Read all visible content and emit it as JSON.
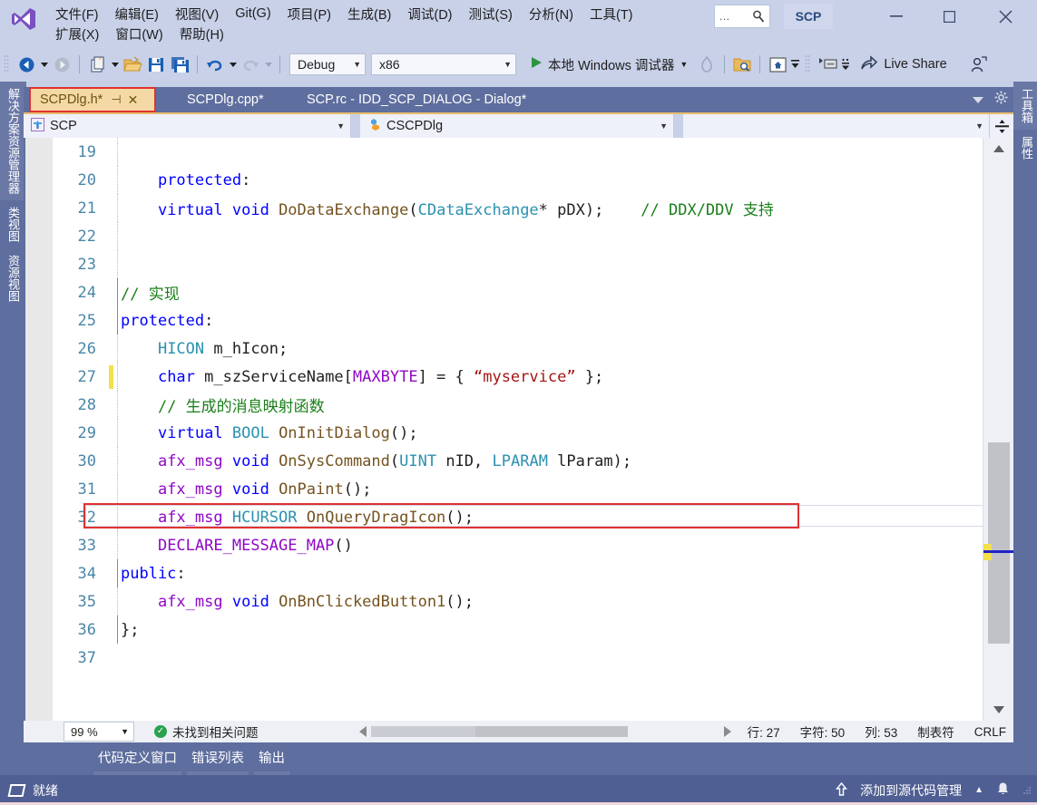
{
  "menu": {
    "logo": "visual-studio-logo",
    "row1": [
      {
        "label": "文件(F)",
        "accel": "F"
      },
      {
        "label": "编辑(E)",
        "accel": "E"
      },
      {
        "label": "视图(V)",
        "accel": "V"
      },
      {
        "label": "Git(G)",
        "accel": "G"
      },
      {
        "label": "项目(P)",
        "accel": "P"
      },
      {
        "label": "生成(B)",
        "accel": "B"
      },
      {
        "label": "调试(D)",
        "accel": "D"
      },
      {
        "label": "测试(S)",
        "accel": "S"
      },
      {
        "label": "分析(N)",
        "accel": "N"
      },
      {
        "label": "工具(T)",
        "accel": "T"
      }
    ],
    "row2": [
      {
        "label": "扩展(X)",
        "accel": "X"
      },
      {
        "label": "窗口(W)",
        "accel": "W"
      },
      {
        "label": "帮助(H)",
        "accel": "H"
      }
    ],
    "search_placeholder": "...",
    "project_badge": "SCP",
    "window_min": "–",
    "window_max": "□",
    "window_close": "✕"
  },
  "toolbar": {
    "back_icon": "back-arrow-icon",
    "forward_icon": "forward-arrow-icon",
    "new_item_icon": "new-item-icon",
    "open_icon": "open-folder-icon",
    "save_icon": "save-icon",
    "save_all_icon": "save-all-icon",
    "undo_icon": "undo-icon",
    "redo_icon": "redo-icon",
    "config_value": "Debug",
    "platform_value": "x86",
    "run_label": "本地 Windows 调试器",
    "hot_reload_icon": "hot-reload-icon",
    "find_icon": "find-in-files-icon",
    "home_icon": "solution-explorer-icon",
    "properties_icon": "properties-window-icon",
    "live_share_label": "Live Share",
    "live_share_icon": "share-icon",
    "feedback_icon": "feedback-icon"
  },
  "left_tool_tabs": [
    {
      "label": "解决方案资源管理器",
      "selected": true
    },
    {
      "label": "类视图",
      "selected": false
    },
    {
      "label": "资源视图",
      "selected": false
    }
  ],
  "right_tool_tabs": [
    {
      "label": "工具箱",
      "selected": false
    },
    {
      "label": "属性",
      "selected": false
    }
  ],
  "document_tabs": [
    {
      "label": "SCPDlg.h*",
      "active": true,
      "pin": "⊣",
      "close": "✕"
    },
    {
      "label": "SCPDlg.cpp*",
      "active": false
    },
    {
      "label": "SCP.rc - IDD_SCP_DIALOG - Dialog*",
      "active": false
    }
  ],
  "tabstrip_actions": {
    "overflow_icon": "chevron-down-icon",
    "settings_icon": "gear-icon"
  },
  "navbar": {
    "project_value": "SCP",
    "project_icon": "project-icon",
    "class_value": "CSCPDlg",
    "class_icon": "class-icon",
    "member_value": "",
    "split_icon": "split-editor-icon"
  },
  "editor": {
    "first_line": 19,
    "lines": [
      {
        "num": 19,
        "changed": false,
        "guide": "dot",
        "tokens": []
      },
      {
        "num": 20,
        "changed": false,
        "guide": "dot",
        "tokens": [
          {
            "t": "    ",
            "c": "pl"
          },
          {
            "t": "protected",
            "c": "kw"
          },
          {
            "t": ":",
            "c": "pl"
          }
        ]
      },
      {
        "num": 21,
        "changed": false,
        "guide": "dot",
        "tokens": [
          {
            "t": "    ",
            "c": "pl"
          },
          {
            "t": "virtual",
            "c": "kw"
          },
          {
            "t": " ",
            "c": "pl"
          },
          {
            "t": "void",
            "c": "kw"
          },
          {
            "t": " ",
            "c": "pl"
          },
          {
            "t": "DoDataExchange",
            "c": "fn"
          },
          {
            "t": "(",
            "c": "pl"
          },
          {
            "t": "CDataExchange",
            "c": "typ"
          },
          {
            "t": "* pDX);",
            "c": "pl"
          },
          {
            "t": "    ",
            "c": "pl"
          },
          {
            "t": "// DDX/DDV 支持",
            "c": "cmt"
          }
        ]
      },
      {
        "num": 22,
        "changed": false,
        "guide": "dot",
        "tokens": []
      },
      {
        "num": 23,
        "changed": false,
        "guide": "dot",
        "tokens": []
      },
      {
        "num": 24,
        "changed": false,
        "guide": "solid",
        "tokens": [
          {
            "t": "// 实现",
            "c": "cmt"
          }
        ]
      },
      {
        "num": 25,
        "changed": false,
        "guide": "solid",
        "tokens": [
          {
            "t": "protected",
            "c": "kw"
          },
          {
            "t": ":",
            "c": "pl"
          }
        ]
      },
      {
        "num": 26,
        "changed": false,
        "guide": "dot",
        "tokens": [
          {
            "t": "    ",
            "c": "pl"
          },
          {
            "t": "HICON",
            "c": "typ"
          },
          {
            "t": " m_hIcon;",
            "c": "pl"
          }
        ]
      },
      {
        "num": 27,
        "changed": true,
        "guide": "dot",
        "highlight": true,
        "tokens": [
          {
            "t": "    ",
            "c": "pl"
          },
          {
            "t": "char",
            "c": "kw"
          },
          {
            "t": " m_szServiceName[",
            "c": "pl"
          },
          {
            "t": "MAXBYTE",
            "c": "mac"
          },
          {
            "t": "] = { ",
            "c": "pl"
          },
          {
            "t": "“myservice”",
            "c": "str"
          },
          {
            "t": " };",
            "c": "pl"
          }
        ]
      },
      {
        "num": 28,
        "changed": false,
        "guide": "dot",
        "tokens": [
          {
            "t": "    ",
            "c": "pl"
          },
          {
            "t": "// 生成的消息映射函数",
            "c": "cmt"
          }
        ]
      },
      {
        "num": 29,
        "changed": false,
        "guide": "dot",
        "tokens": [
          {
            "t": "    ",
            "c": "pl"
          },
          {
            "t": "virtual",
            "c": "kw"
          },
          {
            "t": " ",
            "c": "pl"
          },
          {
            "t": "BOOL",
            "c": "typ"
          },
          {
            "t": " ",
            "c": "pl"
          },
          {
            "t": "OnInitDialog",
            "c": "fn"
          },
          {
            "t": "();",
            "c": "pl"
          }
        ]
      },
      {
        "num": 30,
        "changed": false,
        "guide": "dot",
        "tokens": [
          {
            "t": "    ",
            "c": "pl"
          },
          {
            "t": "afx_msg",
            "c": "kw2"
          },
          {
            "t": " ",
            "c": "pl"
          },
          {
            "t": "void",
            "c": "kw"
          },
          {
            "t": " ",
            "c": "pl"
          },
          {
            "t": "OnSysCommand",
            "c": "fn"
          },
          {
            "t": "(",
            "c": "pl"
          },
          {
            "t": "UINT",
            "c": "typ"
          },
          {
            "t": " nID, ",
            "c": "pl"
          },
          {
            "t": "LPARAM",
            "c": "typ"
          },
          {
            "t": " lParam);",
            "c": "pl"
          }
        ]
      },
      {
        "num": 31,
        "changed": false,
        "guide": "dot",
        "tokens": [
          {
            "t": "    ",
            "c": "pl"
          },
          {
            "t": "afx_msg",
            "c": "kw2"
          },
          {
            "t": " ",
            "c": "pl"
          },
          {
            "t": "void",
            "c": "kw"
          },
          {
            "t": " ",
            "c": "pl"
          },
          {
            "t": "OnPaint",
            "c": "fn"
          },
          {
            "t": "();",
            "c": "pl"
          }
        ]
      },
      {
        "num": 32,
        "changed": false,
        "guide": "dot",
        "tokens": [
          {
            "t": "    ",
            "c": "pl"
          },
          {
            "t": "afx_msg",
            "c": "kw2"
          },
          {
            "t": " ",
            "c": "pl"
          },
          {
            "t": "HCURSOR",
            "c": "typ"
          },
          {
            "t": " ",
            "c": "pl"
          },
          {
            "t": "OnQueryDragIcon",
            "c": "fn"
          },
          {
            "t": "();",
            "c": "pl"
          }
        ]
      },
      {
        "num": 33,
        "changed": false,
        "guide": "dot",
        "tokens": [
          {
            "t": "    ",
            "c": "pl"
          },
          {
            "t": "DECLARE_MESSAGE_MAP",
            "c": "mac"
          },
          {
            "t": "()",
            "c": "pl"
          }
        ]
      },
      {
        "num": 34,
        "changed": false,
        "guide": "solid",
        "tokens": [
          {
            "t": "public",
            "c": "kw"
          },
          {
            "t": ":",
            "c": "pl"
          }
        ]
      },
      {
        "num": 35,
        "changed": false,
        "guide": "dot",
        "tokens": [
          {
            "t": "    ",
            "c": "pl"
          },
          {
            "t": "afx_msg",
            "c": "kw2"
          },
          {
            "t": " ",
            "c": "pl"
          },
          {
            "t": "void",
            "c": "kw"
          },
          {
            "t": " ",
            "c": "pl"
          },
          {
            "t": "OnBnClickedButton1",
            "c": "fn"
          },
          {
            "t": "();",
            "c": "pl"
          }
        ]
      },
      {
        "num": 36,
        "changed": false,
        "guide": "solid",
        "tokens": [
          {
            "t": "};",
            "c": "pl"
          }
        ]
      },
      {
        "num": 37,
        "changed": false,
        "guide": "none",
        "tokens": []
      }
    ]
  },
  "zoombar": {
    "zoom_value": "99 %",
    "issues_text": "未找到相关问题",
    "issues_icon": "success-check-icon",
    "line_label": "行: 27",
    "char_label": "字符: 50",
    "col_label": "列: 53",
    "tab_label": "制表符",
    "eol_label": "CRLF"
  },
  "bottom_tabs": [
    {
      "label": "代码定义窗口"
    },
    {
      "label": "错误列表"
    },
    {
      "label": "输出"
    }
  ],
  "taskbar": {
    "ready_label": "就绪",
    "ready_icon": "window-icon",
    "source_control_label": "添加到源代码管理",
    "source_control_icon": "upload-arrow-icon",
    "source_control_chevron": "▲",
    "notification_icon": "bell-icon"
  },
  "colors": {
    "chrome": "#c8d1e8",
    "panel": "#5e6e9e",
    "accent_tab": "#f5d9a5",
    "highlight_red": "#e03131",
    "taskbar": "#4f5f93"
  }
}
